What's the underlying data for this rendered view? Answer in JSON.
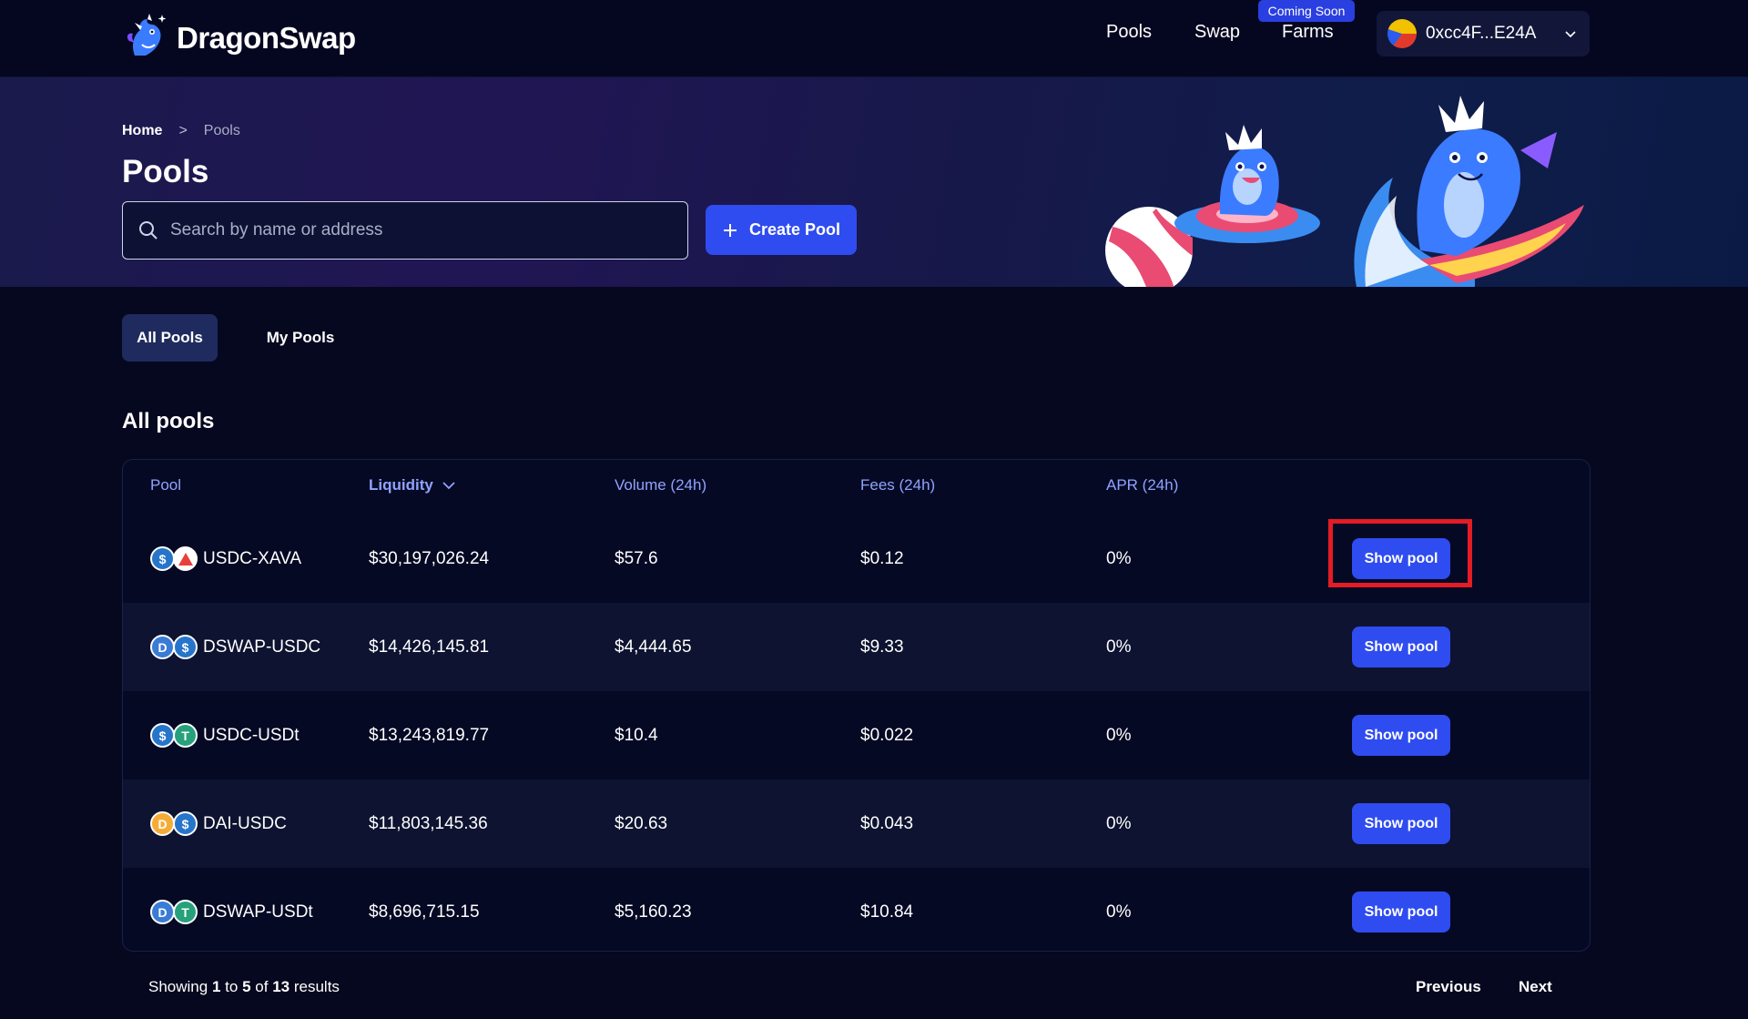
{
  "header": {
    "logo_text": "DragonSwap",
    "nav": {
      "pools": "Pools",
      "swap": "Swap",
      "farms": "Farms",
      "farms_badge": "Coming Soon"
    },
    "wallet_address": "0xcc4F...E24A"
  },
  "breadcrumb": {
    "home": "Home",
    "separator": ">",
    "current": "Pools"
  },
  "page_title": "Pools",
  "search": {
    "placeholder": "Search by name or address",
    "value": ""
  },
  "create_pool_label": "Create Pool",
  "tabs": {
    "all": "All Pools",
    "mine": "My Pools"
  },
  "section_title": "All pools",
  "table": {
    "columns": {
      "pool": "Pool",
      "liquidity": "Liquidity",
      "volume": "Volume (24h)",
      "fees": "Fees (24h)",
      "apr": "APR (24h)"
    },
    "action_label": "Show pool",
    "rows": [
      {
        "pool": "USDC-XAVA",
        "liquidity": "$30,197,026.24",
        "volume": "$57.6",
        "fees": "$0.12",
        "apr": "0%"
      },
      {
        "pool": "DSWAP-USDC",
        "liquidity": "$14,426,145.81",
        "volume": "$4,444.65",
        "fees": "$9.33",
        "apr": "0%"
      },
      {
        "pool": "USDC-USDt",
        "liquidity": "$13,243,819.77",
        "volume": "$10.4",
        "fees": "$0.022",
        "apr": "0%"
      },
      {
        "pool": "DAI-USDC",
        "liquidity": "$11,803,145.36",
        "volume": "$20.63",
        "fees": "$0.043",
        "apr": "0%"
      },
      {
        "pool": "DSWAP-USDt",
        "liquidity": "$8,696,715.15",
        "volume": "$5,160.23",
        "fees": "$10.84",
        "apr": "0%"
      }
    ]
  },
  "pagination": {
    "showing_prefix": "Showing",
    "from": "1",
    "to_word": "to",
    "to": "5",
    "of_word": "of",
    "total": "13",
    "suffix": "results",
    "previous": "Previous",
    "next": "Next"
  },
  "colors": {
    "background": "#06081f",
    "accent": "#2f4cf0",
    "header_text": "#8fa3ff",
    "highlight": "#e31c25"
  }
}
